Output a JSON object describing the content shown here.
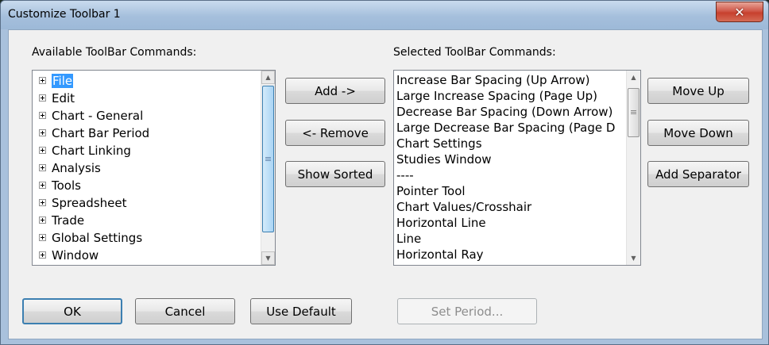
{
  "window": {
    "title": "Customize Toolbar 1",
    "close_glyph": "✕"
  },
  "available": {
    "label": "Available ToolBar Commands:",
    "items": [
      "File",
      "Edit",
      "Chart - General",
      "Chart Bar Period",
      "Chart Linking",
      "Analysis",
      "Tools",
      "Spreadsheet",
      "Trade",
      "Global Settings",
      "Window"
    ]
  },
  "selected": {
    "label": "Selected ToolBar Commands:",
    "items": [
      "Increase Bar Spacing (Up Arrow)",
      "Large Increase Spacing (Page Up)",
      "Decrease Bar Spacing (Down Arrow)",
      "Large Decrease Bar Spacing (Page D",
      "Chart Settings",
      "Studies Window",
      "----",
      "Pointer Tool",
      "Chart Values/Crosshair",
      "Horizontal Line",
      "Line",
      "Horizontal Ray"
    ]
  },
  "buttons": {
    "add": "Add ->",
    "remove": "<- Remove",
    "show_sorted": "Show Sorted",
    "move_up": "Move Up",
    "move_down": "Move Down",
    "add_separator": "Add Separator",
    "ok": "OK",
    "cancel": "Cancel",
    "use_default": "Use Default",
    "set_period": "Set Period..."
  },
  "scroll_glyphs": {
    "up": "▲",
    "down": "▼"
  }
}
